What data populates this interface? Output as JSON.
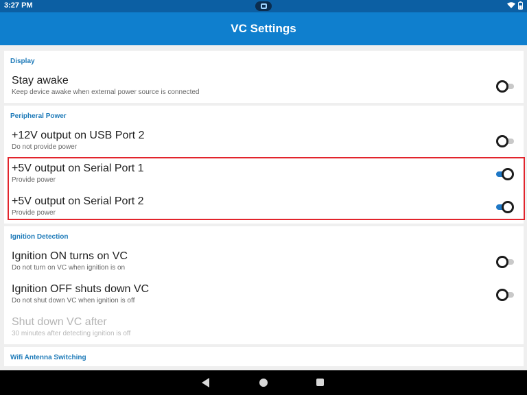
{
  "status_bar": {
    "time": "3:27 PM"
  },
  "app_bar": {
    "title": "VC Settings"
  },
  "sections": {
    "display": {
      "header": "Display",
      "stay_awake": {
        "title": "Stay awake",
        "summary": "Keep device awake when external power source is connected",
        "on": false
      }
    },
    "peripheral_power": {
      "header": "Peripheral Power",
      "usb_12v": {
        "title": "+12V output on USB Port 2",
        "summary": "Do not provide power",
        "on": false
      },
      "serial1_5v": {
        "title": "+5V output on Serial Port 1",
        "summary": "Provide power",
        "on": true
      },
      "serial2_5v": {
        "title": "+5V output on Serial Port 2",
        "summary": "Provide power",
        "on": true
      }
    },
    "ignition": {
      "header": "Ignition Detection",
      "ignition_on": {
        "title": "Ignition ON turns on VC",
        "summary": "Do not turn on VC when ignition is on",
        "on": false
      },
      "ignition_off": {
        "title": "Ignition OFF shuts down VC",
        "summary": "Do not shut down VC when ignition is off",
        "on": false
      },
      "shutdown_after": {
        "title": "Shut down VC after",
        "summary": "30 minutes after detecting ignition is off",
        "enabled": false
      }
    },
    "wifi": {
      "header": "Wifi Antenna Switching"
    }
  },
  "colors": {
    "status_bar": "#0c5fa3",
    "app_bar": "#0f7fce",
    "accent": "#1f7bb9",
    "toggle_on": "#1f78c6",
    "highlight": "#e2242c"
  },
  "icons": {
    "status_center": "screen-recording-icon",
    "status_right": [
      "wifi-icon",
      "battery-icon"
    ],
    "nav": [
      "back-icon",
      "home-icon",
      "recents-icon"
    ]
  }
}
